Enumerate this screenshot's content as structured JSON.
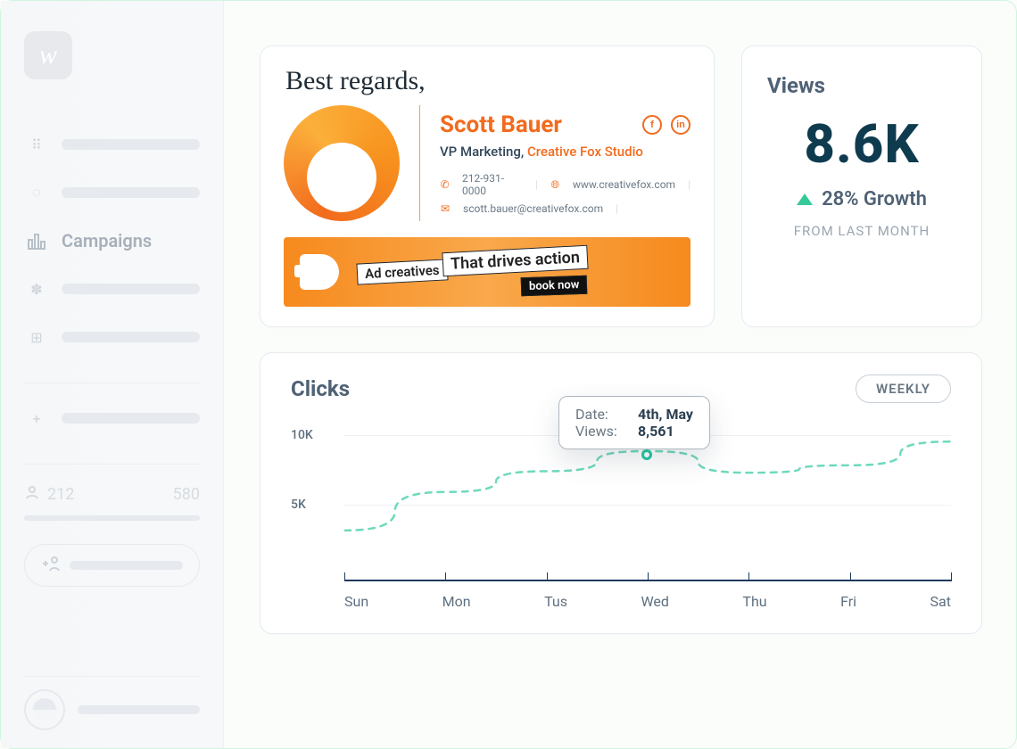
{
  "sidebar": {
    "active_label": "Campaigns",
    "stat_a": "212",
    "stat_b": "580"
  },
  "signature": {
    "greeting": "Best regards,",
    "name": "Scott Bauer",
    "role": "VP Marketing, ",
    "company": "Creative Fox Studio",
    "phone": "212-931-0000",
    "website": "www.creativefox.com",
    "email": "scott.bauer@creativefox.com",
    "banner_a": "Ad creatives",
    "banner_b": "That drives action",
    "banner_cta": "book now"
  },
  "views": {
    "title": "Views",
    "value": "8.6K",
    "growth": "28% Growth",
    "sub": "FROM LAST MONTH"
  },
  "clicks": {
    "title": "Clicks",
    "range_chip": "WEEKLY",
    "y_hi": "10K",
    "y_mid": "5K",
    "tooltip_date_label": "Date:",
    "tooltip_views_label": "Views:",
    "tooltip_date": "4th, May",
    "tooltip_views": "8,561"
  },
  "chart_data": {
    "type": "line",
    "title": "Clicks",
    "ylabel": "Clicks",
    "ylim": [
      0,
      10000
    ],
    "categories": [
      "Sun",
      "Mon",
      "Tus",
      "Wed",
      "Thu",
      "Fri",
      "Sat"
    ],
    "values": [
      3200,
      5800,
      7200,
      8561,
      7100,
      7600,
      9200
    ],
    "tooltip": {
      "index": 3,
      "date": "4th, May",
      "views": 8561
    }
  }
}
